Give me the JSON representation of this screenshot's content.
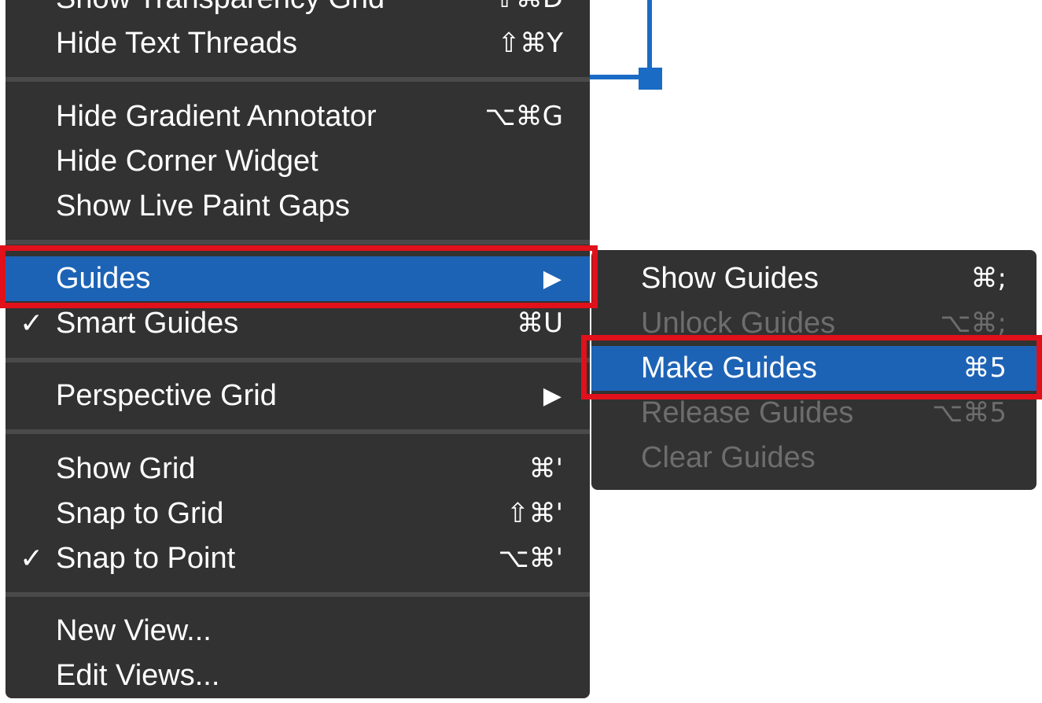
{
  "main_menu": {
    "partial_item": {
      "label": "Show Transparency Grid",
      "shortcut": "⇧⌘D"
    },
    "items": [
      {
        "label": "Hide Text Threads",
        "shortcut": "⇧⌘Y"
      },
      {
        "label": "Hide Gradient Annotator",
        "shortcut": "⌥⌘G"
      },
      {
        "label": "Hide Corner Widget",
        "shortcut": ""
      },
      {
        "label": "Show Live Paint Gaps",
        "shortcut": ""
      },
      {
        "label": "Guides",
        "arrow": "▶"
      },
      {
        "label": "Smart Guides",
        "shortcut": "⌘U",
        "check": "✓"
      },
      {
        "label": "Perspective Grid",
        "arrow": "▶"
      },
      {
        "label": "Show Grid",
        "shortcut": "⌘'"
      },
      {
        "label": "Snap to Grid",
        "shortcut": "⇧⌘'"
      },
      {
        "label": "Snap to Point",
        "shortcut": "⌥⌘'",
        "check": "✓"
      },
      {
        "label": "New View...",
        "shortcut": ""
      },
      {
        "label": "Edit Views...",
        "shortcut": ""
      }
    ]
  },
  "guides_submenu": {
    "items": [
      {
        "label": "Show Guides",
        "shortcut": "⌘;",
        "enabled": true
      },
      {
        "label": "Unlock Guides",
        "shortcut": "⌥⌘;",
        "enabled": false
      },
      {
        "label": "Make Guides",
        "shortcut": "⌘5",
        "enabled": true
      },
      {
        "label": "Release Guides",
        "shortcut": "⌥⌘5",
        "enabled": false
      },
      {
        "label": "Clear Guides",
        "shortcut": "",
        "enabled": false
      }
    ]
  },
  "colors": {
    "menu_bg": "#323232",
    "highlight": "#1d63b5",
    "callout_red": "#e0111b",
    "disabled_text": "#6d6d6d",
    "artwork_blue": "#1a6bc4"
  }
}
